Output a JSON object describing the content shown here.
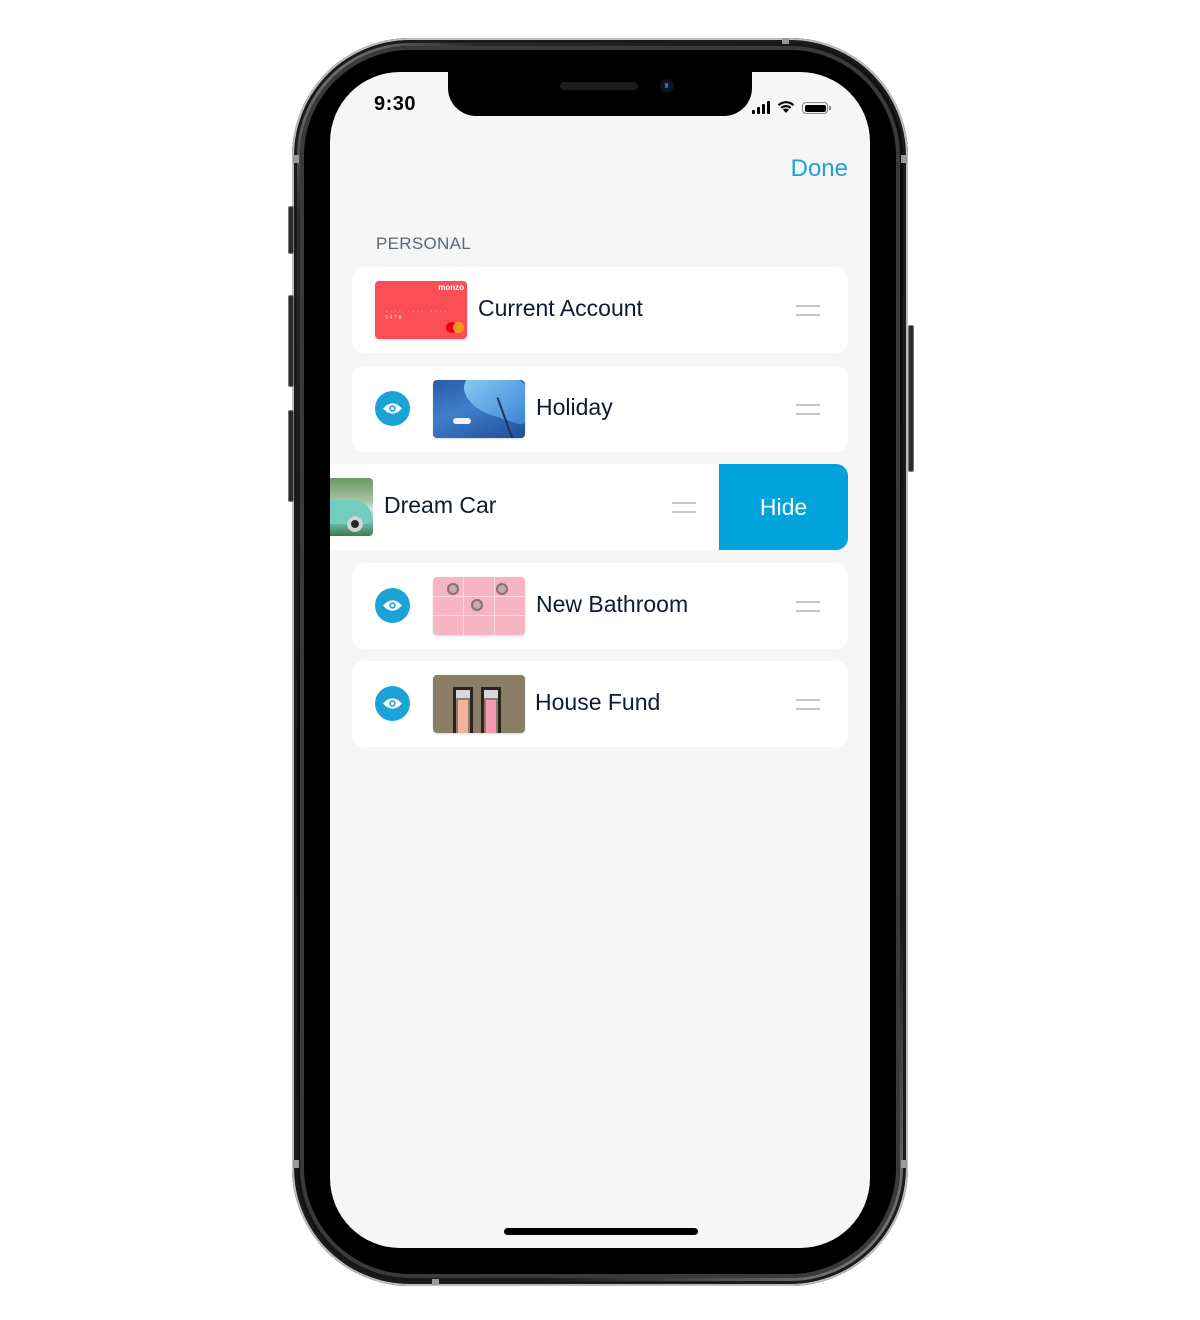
{
  "status_bar": {
    "time": "9:30",
    "icons": [
      "signal-icon",
      "wifi-icon",
      "battery-icon"
    ]
  },
  "header": {
    "done_label": "Done"
  },
  "section": {
    "label": "PERSONAL"
  },
  "accounts": [
    {
      "name": "Current Account",
      "thumbnail": "monzo-card",
      "card_brand": "monzo",
      "card_number": "····  ····  ····  5478",
      "visibility_toggle": false
    },
    {
      "name": "Holiday",
      "thumbnail": "umbrella-photo",
      "visibility_toggle": true
    },
    {
      "name": "Dream Car",
      "thumbnail": "car-photo",
      "swiped": true,
      "swipe_action_label": "Hide"
    },
    {
      "name": "New Bathroom",
      "thumbnail": "pink-tiles-photo",
      "visibility_toggle": true
    },
    {
      "name": "House Fund",
      "thumbnail": "doors-photo",
      "visibility_toggle": true
    }
  ],
  "colors": {
    "accent": "#1ba3d8",
    "hide_action": "#02a3da",
    "card_red": "#fb4f57",
    "background": "#f6f6f6",
    "text_primary": "#0f1b2d",
    "section_label": "#5b6777"
  }
}
